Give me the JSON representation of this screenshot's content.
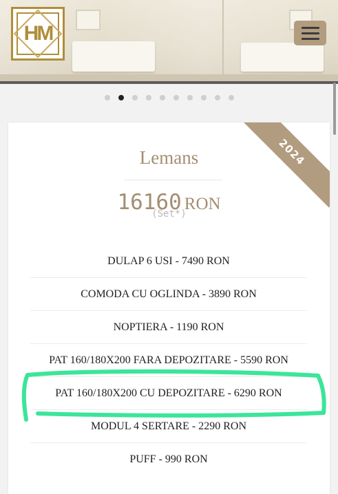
{
  "header": {
    "logo_text": "HM",
    "menu_icon": "hamburger-menu-icon"
  },
  "carousel": {
    "slide_count": 10,
    "active_index": 1
  },
  "package": {
    "ribbon": "2024",
    "title": "Lemans",
    "price": "16160",
    "currency": "RON",
    "note": "(Set*)",
    "items": [
      "DULAP 6 USI - 7490 RON",
      "COMODA CU OGLINDA - 3890 RON",
      "NOPTIERA - 1190 RON",
      "PAT 160/180X200 FARA DEPOZITARE - 5590 RON",
      "PAT 160/180X200 CU DEPOZITARE - 6290 RON",
      "MODUL 4 SERTARE - 2290 RON",
      "PUFF - 990 RON"
    ]
  },
  "colors": {
    "accent": "#a38e72",
    "ribbon": "#b29c7f",
    "logo_gold": "#b08d3a",
    "highlight": "#3be59a"
  }
}
